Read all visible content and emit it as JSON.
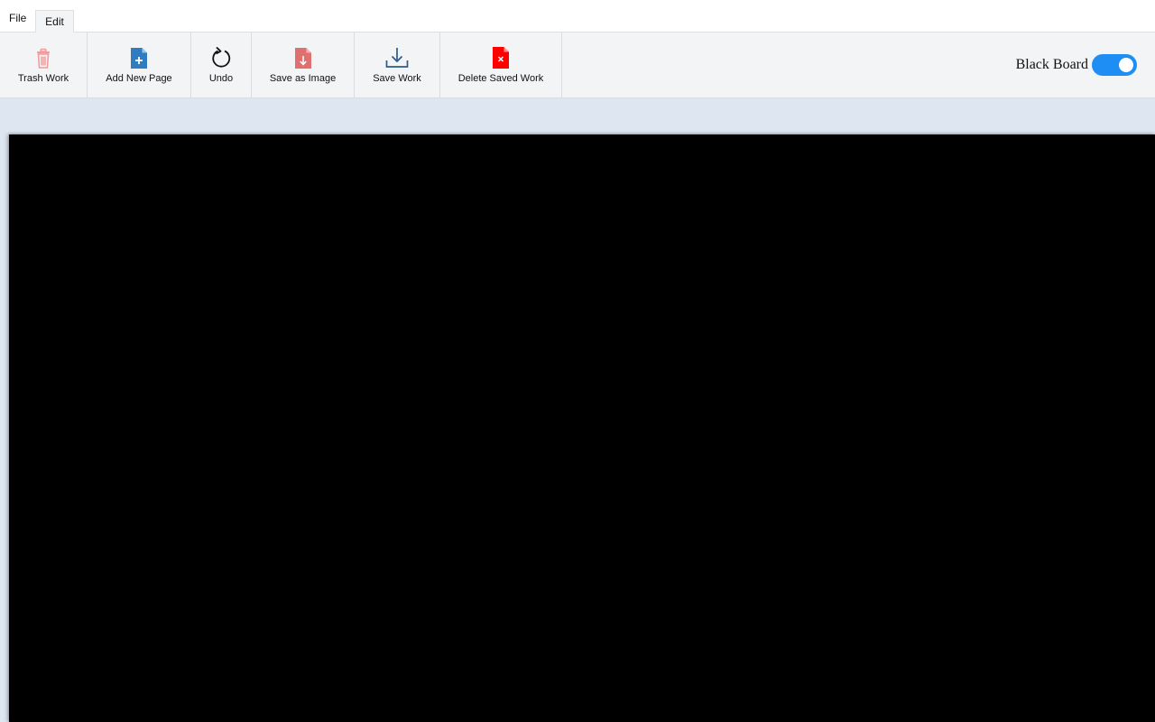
{
  "menu": {
    "tabs": [
      {
        "label": "File",
        "active": false
      },
      {
        "label": "Edit",
        "active": true
      }
    ]
  },
  "toolbar": {
    "tools": [
      {
        "label": "Trash Work",
        "icon": "trash-icon",
        "color": "#f08080"
      },
      {
        "label": "Add New Page",
        "icon": "add-page-icon",
        "color": "#2f7dc0"
      },
      {
        "label": "Undo",
        "icon": "undo-icon",
        "color": "#111111"
      },
      {
        "label": "Save as Image",
        "icon": "save-image-icon",
        "color": "#e06f6f"
      },
      {
        "label": "Save Work",
        "icon": "download-icon",
        "color": "#2c5a8a"
      },
      {
        "label": "Delete Saved Work",
        "icon": "delete-file-icon",
        "color": "#ff0000"
      }
    ],
    "blackboard_toggle": {
      "label": "Black Board",
      "on": true,
      "accent": "#1e8ef5"
    }
  },
  "canvas": {
    "background": "#000000",
    "workspace_background": "#dde6f1"
  }
}
